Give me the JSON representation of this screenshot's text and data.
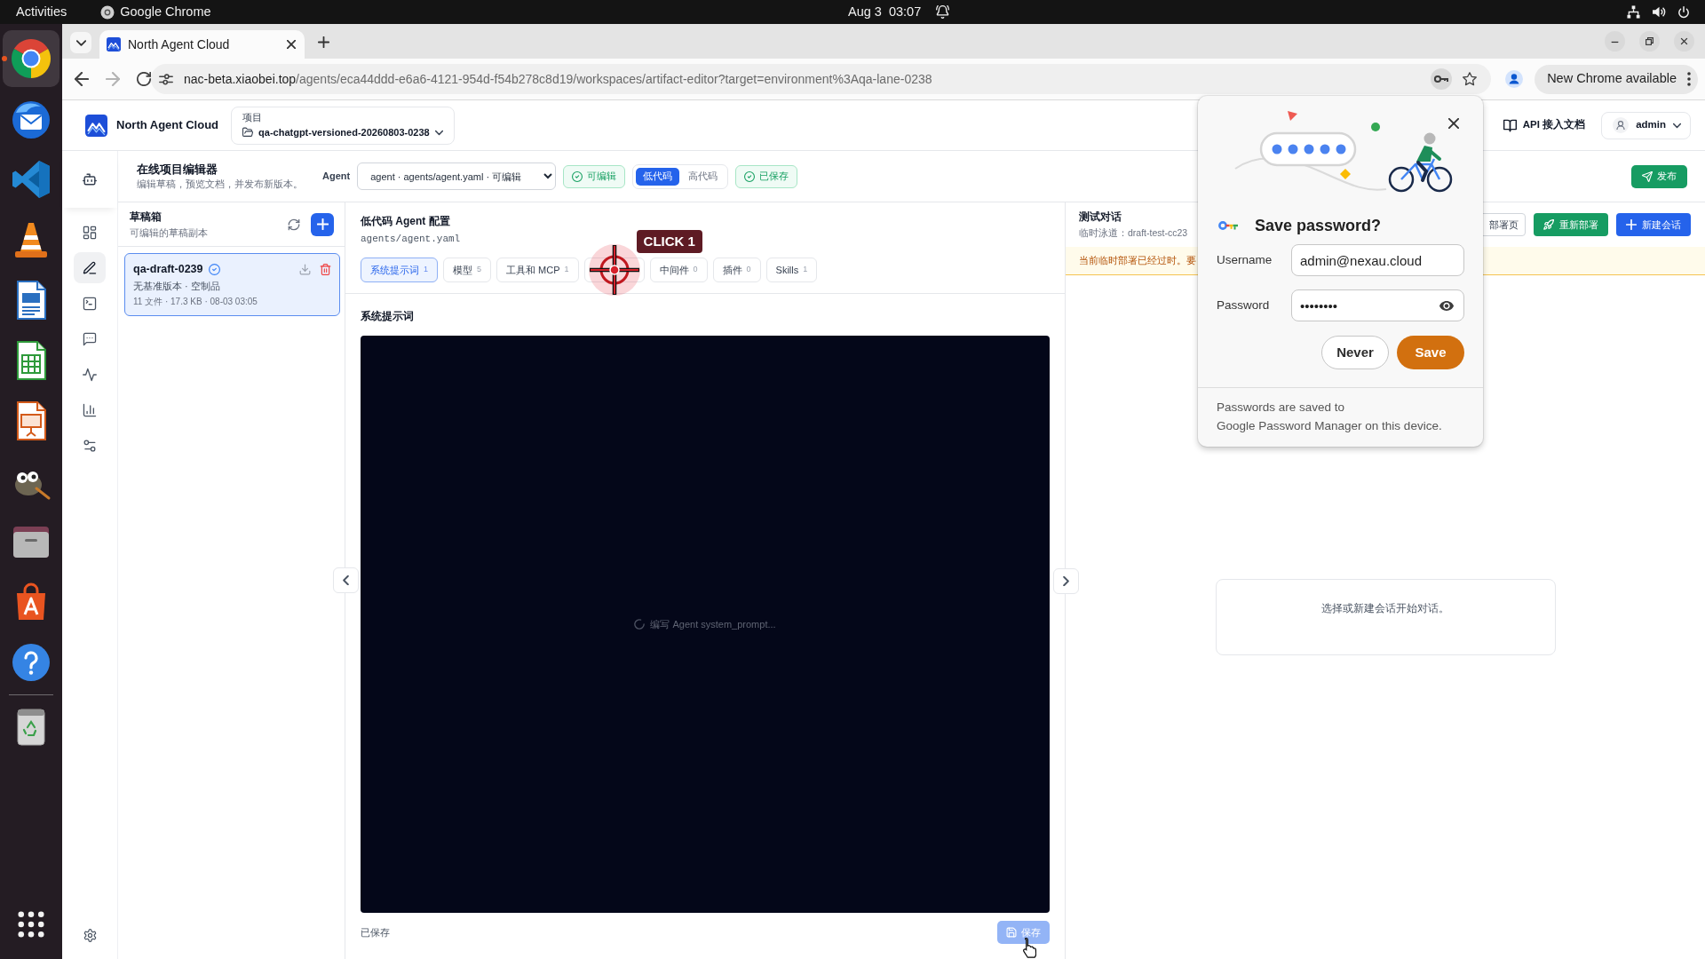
{
  "top_bar": {
    "activities": "Activities",
    "app_name": "Google Chrome",
    "clock": "Aug 3  03:07"
  },
  "dock": [
    {
      "active": true
    },
    {
      "active": false
    },
    {
      "active": false
    },
    {
      "active": false
    },
    {
      "active": false
    },
    {
      "active": false
    },
    {
      "active": false
    },
    {
      "active": false
    },
    {
      "active": false
    },
    {
      "active": false
    },
    {
      "active": false
    },
    {
      "active": false
    }
  ],
  "browser": {
    "tabs": [
      {
        "title": "North Agent Cloud",
        "selected": true
      }
    ],
    "forward_disabled": true,
    "url_host": "nac-beta.xiaobei.top",
    "url_path": "/agents/eca44ddd-e6a6-4121-954d-f54b278c8d19/workspaces/artifact-editor?target=environment%3Aqa-lane-0238",
    "update_label": "New Chrome available"
  },
  "header": {
    "brand": "North Agent Cloud",
    "project_label": "项目",
    "project_name": "qa-chatgpt-versioned-20260803-0238",
    "docs_link": "API 接入文档",
    "user": "admin"
  },
  "nav": [
    {
      "selected": false
    },
    {
      "selected": true
    },
    {
      "selected": false
    },
    {
      "selected": false
    },
    {
      "selected": false
    },
    {
      "selected": false
    },
    {
      "selected": false
    }
  ],
  "toolbar": {
    "title": "在线项目编辑器",
    "subtitle": "编辑草稿，预览文档，并发布新版本。",
    "agent_label": "Agent",
    "agent_value": "agent · agents/agent.yaml · 可编辑",
    "editable_badge": "可编辑",
    "modes": [
      {
        "label": "低代码",
        "selected": true
      },
      {
        "label": "高代码",
        "selected": false
      }
    ],
    "saved_badge": "已保存",
    "publish": "发布"
  },
  "drafts": {
    "title": "草稿箱",
    "subtitle": "可编辑的草稿副本",
    "items": [
      {
        "name": "qa-draft-0239",
        "verified": true,
        "selected": true,
        "meta": "无基准版本 · 空制品",
        "details": "11 文件 · 17.3 KB · 08-03 03:05"
      }
    ]
  },
  "editor": {
    "title": "低代码 Agent 配置",
    "path": "agents/agent.yaml",
    "tabs": [
      {
        "label": "系统提示词",
        "count": "1",
        "selected": true
      },
      {
        "label": "模型",
        "count": "5",
        "selected": false
      },
      {
        "label": "工具和 MCP",
        "count": "1",
        "selected": false
      },
      {
        "selected": false,
        "click_marker": "CLICK 1"
      },
      {
        "label": "中间件",
        "count": "0",
        "selected": false
      },
      {
        "label": "插件",
        "count": "0",
        "selected": false
      },
      {
        "label": "Skills",
        "count": "1",
        "selected": false
      }
    ],
    "section": "系统提示词",
    "loading": "编写 Agent system_prompt...",
    "status": "已保存",
    "save": {
      "label": "保存",
      "disabled": true
    }
  },
  "chat": {
    "title": "测试对话",
    "lane": "临时泳道：draft-test-cc23",
    "actions": [
      {
        "kind": "outline",
        "label": "部署页"
      },
      {
        "kind": "success",
        "label": "重新部署"
      },
      {
        "kind": "primary",
        "label": "新建会话"
      }
    ],
    "warning": "当前临时部署已经过时。要",
    "empty": "选择或新建会话开始对话。"
  },
  "password_prompt": {
    "title": "Save password?",
    "fields": [
      {
        "kind": "text",
        "label": "Username",
        "value": "admin@nexau.cloud"
      },
      {
        "kind": "password",
        "label": "Password",
        "value": "••••••••"
      }
    ],
    "buttons": [
      {
        "kind": "secondary",
        "label": "Never"
      },
      {
        "kind": "primary",
        "label": "Save"
      }
    ],
    "note_start": "Passwords are saved to ",
    "link": "Google Password Manager",
    "note_end": " on this device."
  }
}
